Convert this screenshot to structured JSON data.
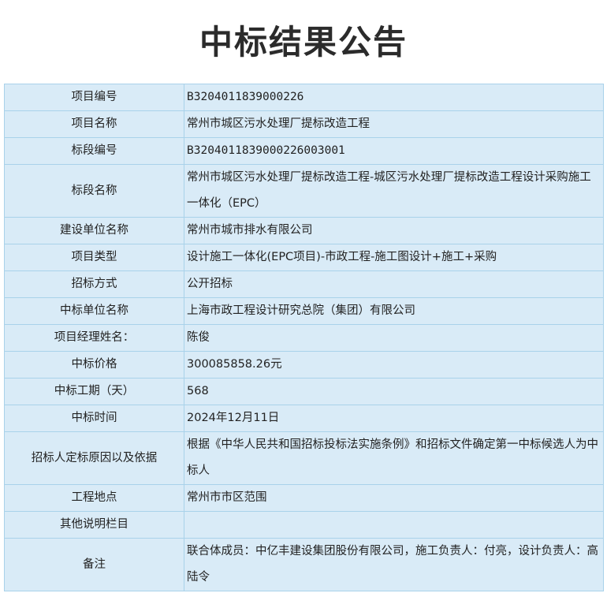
{
  "title": "中标结果公告",
  "rows": [
    {
      "label": "项目编号",
      "value": "B3204011839000226"
    },
    {
      "label": "项目名称",
      "value": "常州市城区污水处理厂提标改造工程"
    },
    {
      "label": "标段编号",
      "value": "B3204011839000226003001"
    },
    {
      "label": "标段名称",
      "value": "常州市城区污水处理厂提标改造工程-城区污水处理厂提标改造工程设计采购施工一体化（EPC）"
    },
    {
      "label": "建设单位名称",
      "value": "常州市城市排水有限公司"
    },
    {
      "label": "项目类型",
      "value": "设计施工一体化(EPC项目)-市政工程-施工图设计+施工+采购"
    },
    {
      "label": "招标方式",
      "value": "公开招标"
    },
    {
      "label": "中标单位名称",
      "value": "上海市政工程设计研究总院（集团）有限公司"
    },
    {
      "label": "项目经理姓名：",
      "value": "陈俊"
    },
    {
      "label": "中标价格",
      "value": "300085858.26元"
    },
    {
      "label": "中标工期（天）",
      "value": "568"
    },
    {
      "label": "中标时间",
      "value": "2024年12月11日"
    },
    {
      "label": "招标人定标原因以及依据",
      "value": "根据《中华人民共和国招标投标法实施条例》和招标文件确定第一中标候选人为中标人"
    },
    {
      "label": "工程地点",
      "value": "常州市市区范围"
    },
    {
      "label": "其他说明栏目",
      "value": ""
    },
    {
      "label": "备注",
      "value": "联合体成员：中亿丰建设集团股份有限公司，施工负责人：付亮，设计负责人：高陆令"
    }
  ]
}
